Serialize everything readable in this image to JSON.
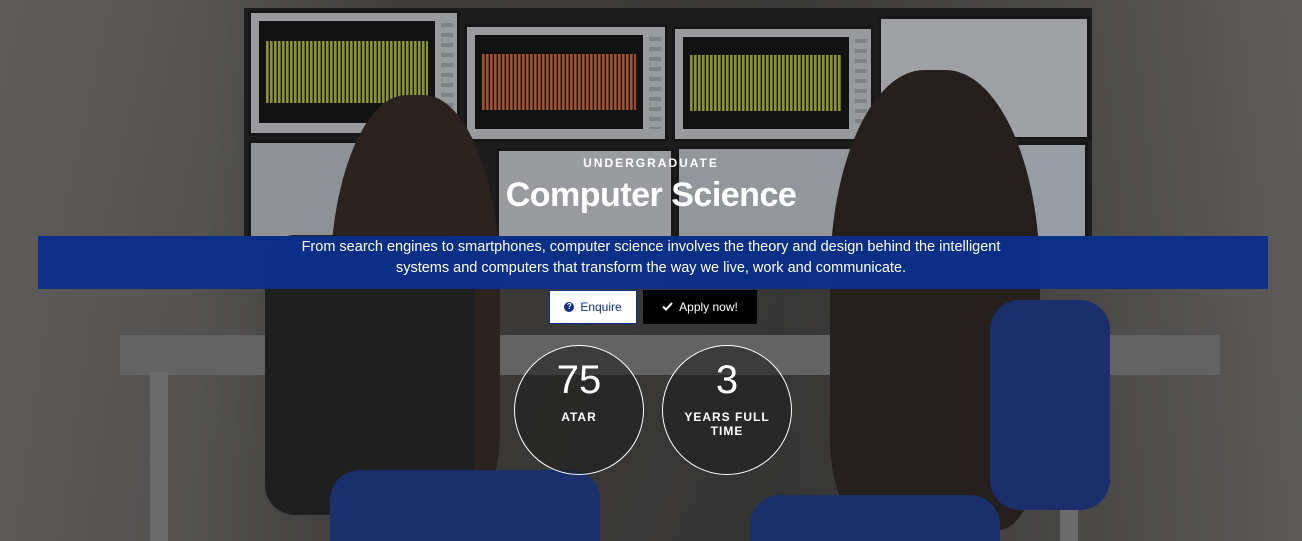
{
  "hero": {
    "eyebrow": "UNDERGRADUATE",
    "title": "Computer Science",
    "intro": "From search engines to smartphones, computer science involves the theory and design behind the intelligent systems and computers that transform the way we live, work and communicate."
  },
  "actions": {
    "enquire_label": "Enquire",
    "enquire_icon": "question-circle-icon",
    "apply_label": "Apply now!",
    "apply_icon": "check-icon"
  },
  "stats": [
    {
      "value": "75",
      "label": "ATAR"
    },
    {
      "value": "3",
      "label": "YEARS FULL TIME"
    }
  ],
  "colors": {
    "band": "#0a2f8a",
    "enquire_bg": "#ffffff",
    "apply_bg": "#000000",
    "text": "#ffffff"
  }
}
